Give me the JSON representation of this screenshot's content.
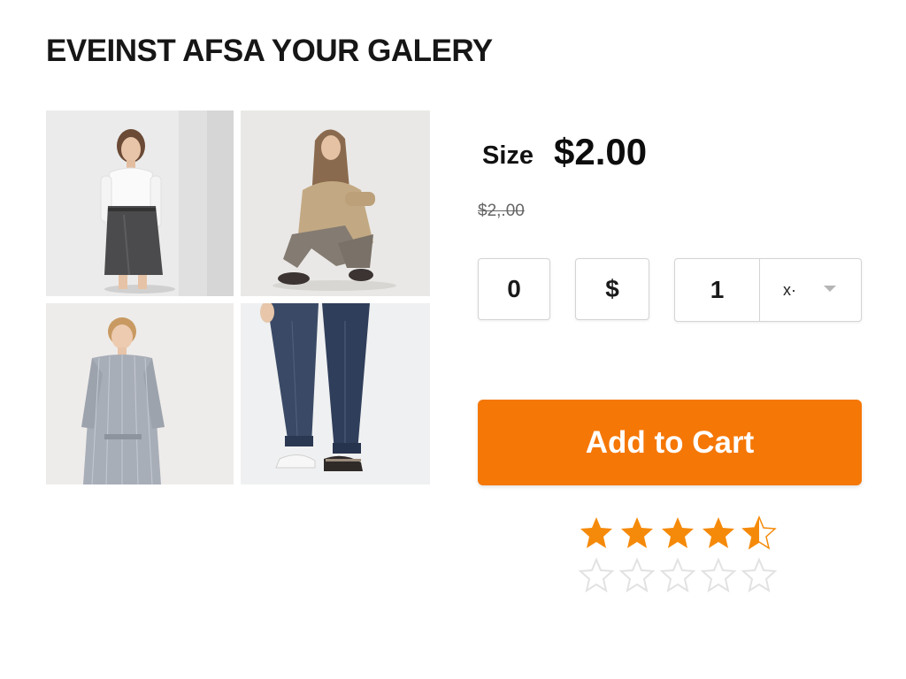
{
  "header": {
    "title": "EVEINST AFSA YOUR GALERY"
  },
  "gallery": {
    "items": [
      {
        "name": "photo-white-shirt-grey-skirt"
      },
      {
        "name": "photo-beige-sweater-seated"
      },
      {
        "name": "photo-striped-shirt-dress"
      },
      {
        "name": "photo-denim-jeans-legs"
      }
    ]
  },
  "product": {
    "size_label": "Size",
    "price": "$2.00",
    "old_price": "$2,.00"
  },
  "controls": {
    "box_a_value": "0",
    "box_b_value": "$",
    "quantity": "1",
    "quantity_select": "x·"
  },
  "cart": {
    "label": "Add to Cart"
  },
  "rating": {
    "value": 4.5,
    "max": 5
  },
  "colors": {
    "accent": "#f57706",
    "star_filled": "#f58a0a",
    "star_empty": "#e2e2e2"
  }
}
